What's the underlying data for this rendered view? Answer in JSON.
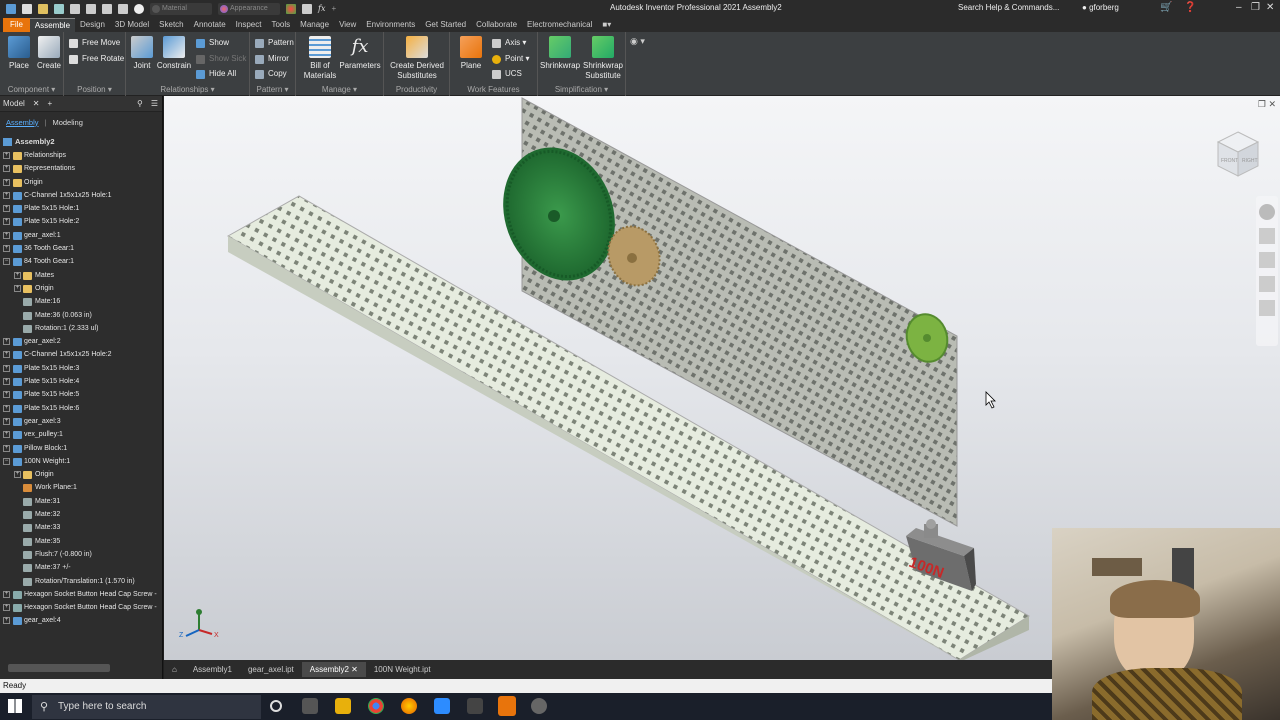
{
  "titlebar": {
    "app_title": "Autodesk Inventor Professional 2021    Assembly2",
    "material_placeholder": "Material",
    "appearance_placeholder": "Appearance",
    "search_help": "Search Help & Commands...",
    "user": "gforberg"
  },
  "tabs": [
    "File",
    "Assemble",
    "Design",
    "3D Model",
    "Sketch",
    "Annotate",
    "Inspect",
    "Tools",
    "Manage",
    "View",
    "Environments",
    "Get Started",
    "Collaborate",
    "Electromechanical"
  ],
  "ribbon": {
    "place": "Place",
    "create": "Create",
    "free_move": "Free Move",
    "free_rotate": "Free Rotate",
    "joint": "Joint",
    "constrain": "Constrain",
    "show": "Show",
    "show_sick": "Show Sick",
    "hide_all": "Hide All",
    "pattern": "Pattern",
    "mirror": "Mirror",
    "copy": "Copy",
    "bill_of": "Bill of",
    "materials": "Materials",
    "parameters": "Parameters",
    "create_derived": "Create Derived",
    "substitutes": "Substitutes",
    "plane": "Plane",
    "axis": "Axis",
    "point": "Point",
    "ucs": "UCS",
    "shrinkwrap": "Shrinkwrap",
    "shrinkwrap2": "Shrinkwrap",
    "substitute": "Substitute",
    "groups": {
      "component": "Component ▾",
      "position": "Position ▾",
      "relationships": "Relationships ▾",
      "pattern": "Pattern ▾",
      "manage": "Manage ▾",
      "productivity": "Productivity",
      "work_features": "Work Features",
      "simplification": "Simplification ▾"
    }
  },
  "browser": {
    "title": "Model",
    "tab_assembly": "Assembly",
    "tab_modeling": "Modeling",
    "root": "Assembly2",
    "nodes": [
      {
        "label": "Relationships",
        "level": 0,
        "exp": "+",
        "icon": "folder"
      },
      {
        "label": "Representations",
        "level": 0,
        "exp": "+",
        "icon": "folder"
      },
      {
        "label": "Origin",
        "level": 0,
        "exp": "+",
        "icon": "folder"
      },
      {
        "label": "C-Channel 1x5x1x25 Hole:1",
        "level": 0,
        "exp": "+",
        "icon": "part"
      },
      {
        "label": "Plate 5x15 Hole:1",
        "level": 0,
        "exp": "+",
        "icon": "part"
      },
      {
        "label": "Plate 5x15 Hole:2",
        "level": 0,
        "exp": "+",
        "icon": "part"
      },
      {
        "label": "gear_axel:1",
        "level": 0,
        "exp": "+",
        "icon": "part"
      },
      {
        "label": "36 Tooth Gear:1",
        "level": 0,
        "exp": "+",
        "icon": "part"
      },
      {
        "label": "84 Tooth Gear:1",
        "level": 0,
        "exp": "−",
        "icon": "part"
      },
      {
        "label": "Mates",
        "level": 1,
        "exp": "+",
        "icon": "folder"
      },
      {
        "label": "Origin",
        "level": 1,
        "exp": "+",
        "icon": "folder"
      },
      {
        "label": "Mate:16",
        "level": 1,
        "exp": "",
        "icon": "constraint"
      },
      {
        "label": "Mate:36 (0.063 in)",
        "level": 1,
        "exp": "",
        "icon": "constraint"
      },
      {
        "label": "Rotation:1 (2.333 ul)",
        "level": 1,
        "exp": "",
        "icon": "constraint"
      },
      {
        "label": "gear_axel:2",
        "level": 0,
        "exp": "+",
        "icon": "part"
      },
      {
        "label": "C-Channel 1x5x1x25 Hole:2",
        "level": 0,
        "exp": "+",
        "icon": "part"
      },
      {
        "label": "Plate 5x15 Hole:3",
        "level": 0,
        "exp": "+",
        "icon": "part"
      },
      {
        "label": "Plate 5x15 Hole:4",
        "level": 0,
        "exp": "+",
        "icon": "part"
      },
      {
        "label": "Plate 5x15 Hole:5",
        "level": 0,
        "exp": "+",
        "icon": "part"
      },
      {
        "label": "Plate 5x15 Hole:6",
        "level": 0,
        "exp": "+",
        "icon": "part"
      },
      {
        "label": "gear_axel:3",
        "level": 0,
        "exp": "+",
        "icon": "part"
      },
      {
        "label": "vex_pulley:1",
        "level": 0,
        "exp": "+",
        "icon": "part"
      },
      {
        "label": "Pillow Block:1",
        "level": 0,
        "exp": "+",
        "icon": "part"
      },
      {
        "label": "100N Weight:1",
        "level": 0,
        "exp": "−",
        "icon": "part"
      },
      {
        "label": "Origin",
        "level": 1,
        "exp": "+",
        "icon": "folder"
      },
      {
        "label": "Work Plane:1",
        "level": 1,
        "exp": "",
        "icon": "plane"
      },
      {
        "label": "Mate:31",
        "level": 1,
        "exp": "",
        "icon": "constraint"
      },
      {
        "label": "Mate:32",
        "level": 1,
        "exp": "",
        "icon": "constraint"
      },
      {
        "label": "Mate:33",
        "level": 1,
        "exp": "",
        "icon": "constraint"
      },
      {
        "label": "Mate:35",
        "level": 1,
        "exp": "",
        "icon": "constraint"
      },
      {
        "label": "Flush:7 (-0.800 in)",
        "level": 1,
        "exp": "",
        "icon": "constraint"
      },
      {
        "label": "Mate:37 +/-",
        "level": 1,
        "exp": "",
        "icon": "constraint"
      },
      {
        "label": "Rotation/Translation:1 (1.570 in)",
        "level": 1,
        "exp": "",
        "icon": "constraint"
      },
      {
        "label": "Hexagon Socket Button Head Cap Screw -",
        "level": 0,
        "exp": "+",
        "icon": "screw"
      },
      {
        "label": "Hexagon Socket Button Head Cap Screw -",
        "level": 0,
        "exp": "+",
        "icon": "screw"
      },
      {
        "label": "gear_axel:4",
        "level": 0,
        "exp": "+",
        "icon": "part"
      }
    ]
  },
  "viewport": {
    "weight_label": "100N",
    "viewcube_front": "FRONT",
    "viewcube_right": "RIGHT",
    "axis_x": "X",
    "axis_y": "Y",
    "axis_z": "Z"
  },
  "doc_tabs": [
    "Assembly1",
    "gear_axel.ipt",
    "Assembly2",
    "100N Weight.ipt"
  ],
  "status": "Ready",
  "taskbar": {
    "search_placeholder": "Type here to search"
  },
  "colors": {
    "accent": "#e8740c",
    "gear_large": "#2e7d3c",
    "gear_small": "#c2a878",
    "pulley": "#8bc34a",
    "weight_text": "#c62828"
  }
}
